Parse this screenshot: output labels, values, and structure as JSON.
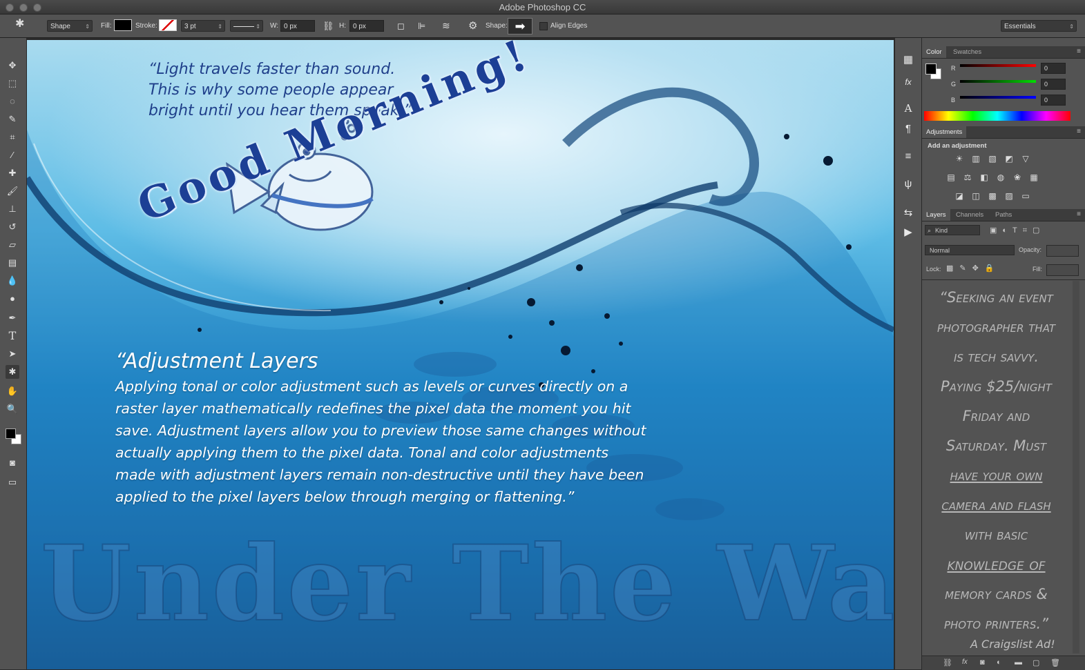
{
  "window": {
    "title": "Adobe Photoshop CC"
  },
  "options_bar": {
    "mode": "Shape",
    "fill_label": "Fill:",
    "stroke_label": "Stroke:",
    "stroke_width": "3 pt",
    "w_label": "W:",
    "w_value": "0 px",
    "h_label": "H:",
    "h_value": "0 px",
    "shape_label": "Shape:",
    "align_edges": "Align Edges",
    "workspace": "Essentials"
  },
  "canvas": {
    "quote_lines": [
      "“Light travels faster than sound.",
      "This is why some people appear",
      "bright until you hear them speak.”"
    ],
    "good_morning": "Good Morning!",
    "adj_title": "“Adjustment Layers",
    "adj_lines": [
      "Applying tonal or color adjustment such as levels or curves directly on a",
      "raster layer mathematically redefines the pixel data the moment you hit",
      "save. Adjustment layers allow you to preview those same changes without",
      "actually applying them to the pixel data. Tonal and color adjustments",
      "made with adjustment layers remain non-destructive until they have been",
      "applied to the pixel layers below through merging or flattening.”"
    ],
    "under_water": "Under The Water!"
  },
  "color_panel": {
    "tabs": [
      "Color",
      "Swatches"
    ],
    "r_label": "R",
    "r_value": "0",
    "g_label": "G",
    "g_value": "0",
    "b_label": "B",
    "b_value": "0"
  },
  "adjustments_panel": {
    "tab": "Adjustments",
    "heading": "Add an adjustment"
  },
  "layers_panel": {
    "tabs": [
      "Layers",
      "Channels",
      "Paths"
    ],
    "filter": "Kind",
    "blend_mode": "Normal",
    "opacity_label": "Opacity:",
    "lock_label": "Lock:",
    "fill_label": "Fill:",
    "ad_lines": [
      "“Seeking an event",
      "photographer that",
      "is tech savvy.",
      "Paying $25/night",
      "Friday and",
      "Saturday. Must",
      "have your own",
      "camera and flash",
      "with basic",
      "knowledge of",
      "memory cards &",
      "photo printers.”"
    ],
    "ad_signature": "A Craigslist Ad!"
  },
  "colors": {
    "accent": "#1c3f95",
    "panel_bg": "#535353"
  }
}
